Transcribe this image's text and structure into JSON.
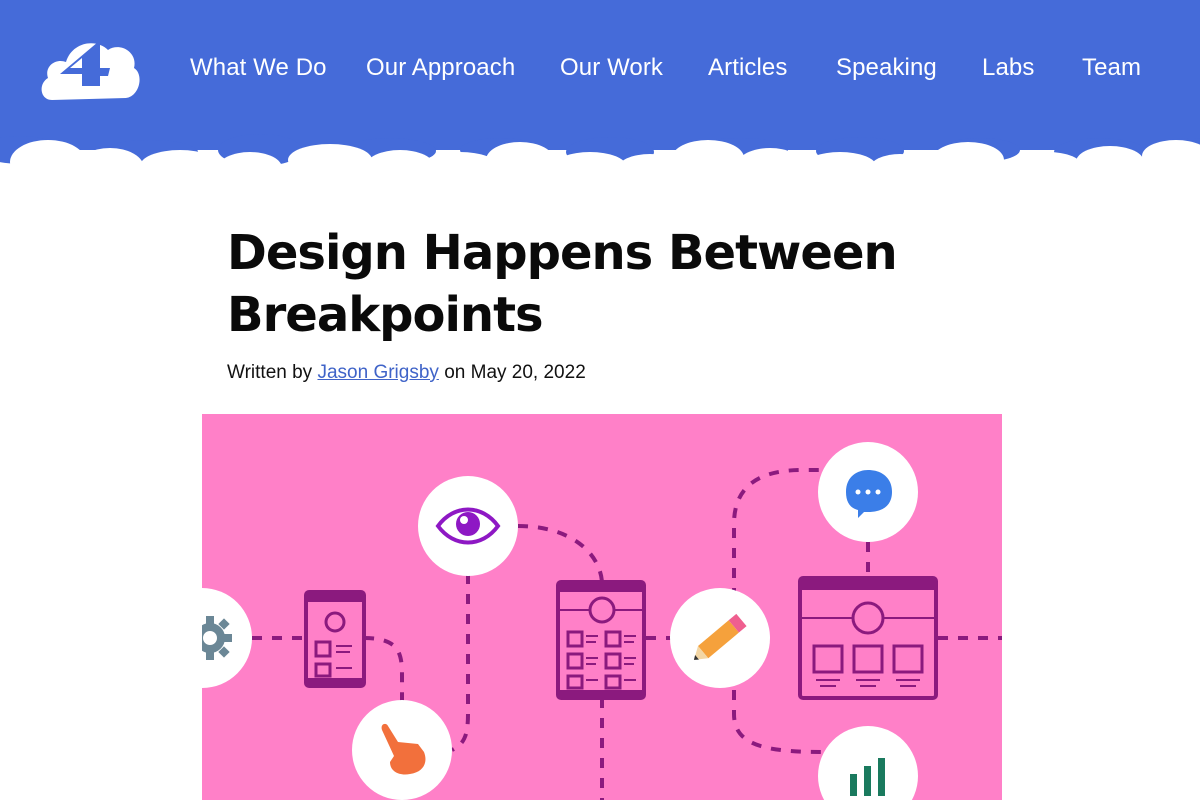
{
  "header": {
    "logo_icon": "cloud-four-logo",
    "nav": [
      {
        "label": "What We Do"
      },
      {
        "label": "Our Approach"
      },
      {
        "label": "Our Work"
      },
      {
        "label": "Articles"
      },
      {
        "label": "Speaking"
      },
      {
        "label": "Labs"
      },
      {
        "label": "Team"
      }
    ],
    "colors": {
      "brand_blue": "#456bd9",
      "background": "#ffffff"
    }
  },
  "article": {
    "title": "Design Happens Between Breakpoints",
    "byline": {
      "prefix": "Written by",
      "author": "Jason Grigsby",
      "date_prefix": "on",
      "date": "May 20, 2022"
    }
  },
  "hero": {
    "background_color": "#ff80c8",
    "accent_color": "#8b1a7e",
    "icons": [
      "gear-icon",
      "phone-wireframe-icon",
      "pointer-hand-icon",
      "eye-icon",
      "tablet-wireframe-icon",
      "pencil-icon",
      "chat-bubble-icon",
      "desktop-wireframe-icon",
      "bar-chart-icon"
    ]
  }
}
